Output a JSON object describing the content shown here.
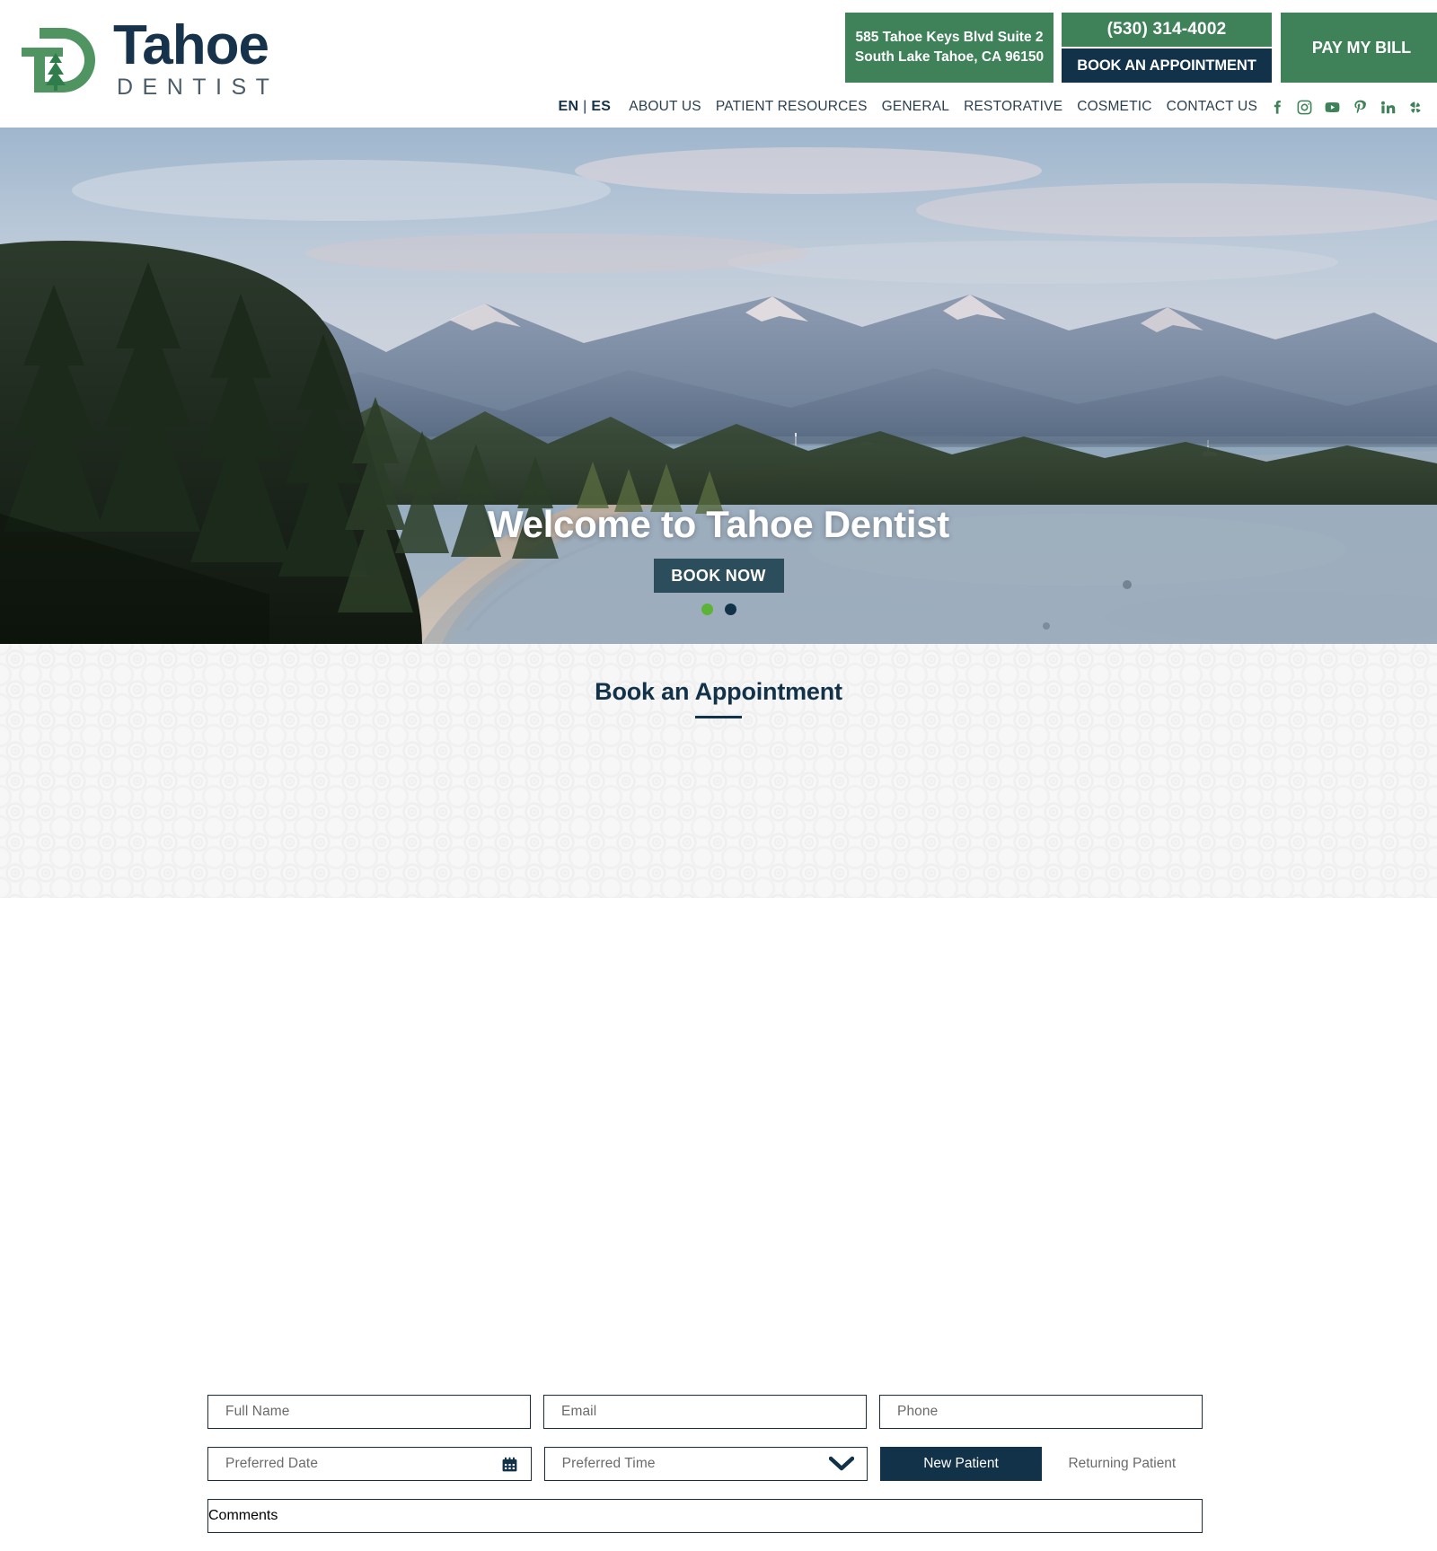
{
  "header": {
    "logo": {
      "word": "Tahoe",
      "sub": "DENTIST",
      "mark_icon": "td-monogram-pine-tree-icon",
      "green": "#3f8259",
      "navy": "#17334b"
    },
    "address_line1": "585 Tahoe Keys Blvd Suite 2",
    "address_line2": "South Lake Tahoe, CA 96150",
    "phone": "(530) 314-4002",
    "book_appointment": "BOOK AN APPOINTMENT",
    "pay_my_bill": "PAY MY BILL"
  },
  "nav": {
    "lang_en": "EN",
    "lang_sep": "|",
    "lang_es": "ES",
    "links": [
      {
        "label": "ABOUT US"
      },
      {
        "label": "PATIENT RESOURCES"
      },
      {
        "label": "GENERAL"
      },
      {
        "label": "RESTORATIVE"
      },
      {
        "label": "COSMETIC"
      },
      {
        "label": "CONTACT US"
      }
    ],
    "socials": [
      {
        "name": "facebook-icon"
      },
      {
        "name": "instagram-icon"
      },
      {
        "name": "youtube-icon"
      },
      {
        "name": "pinterest-icon"
      },
      {
        "name": "linkedin-icon"
      },
      {
        "name": "yelp-icon"
      }
    ]
  },
  "hero": {
    "title": "Welcome to Tahoe Dentist",
    "button": "BOOK NOW",
    "slides": [
      {
        "active": true,
        "color": "#5cb335"
      },
      {
        "active": false,
        "color": "#12324a"
      }
    ]
  },
  "form": {
    "title": "Book an Appointment",
    "full_name_placeholder": "Full Name",
    "email_placeholder": "Email",
    "phone_placeholder": "Phone",
    "preferred_date_placeholder": "Preferred Date",
    "preferred_time_placeholder": "Preferred Time",
    "new_patient_label": "New Patient",
    "returning_patient_label": "Returning Patient",
    "comments_placeholder": "Comments"
  }
}
